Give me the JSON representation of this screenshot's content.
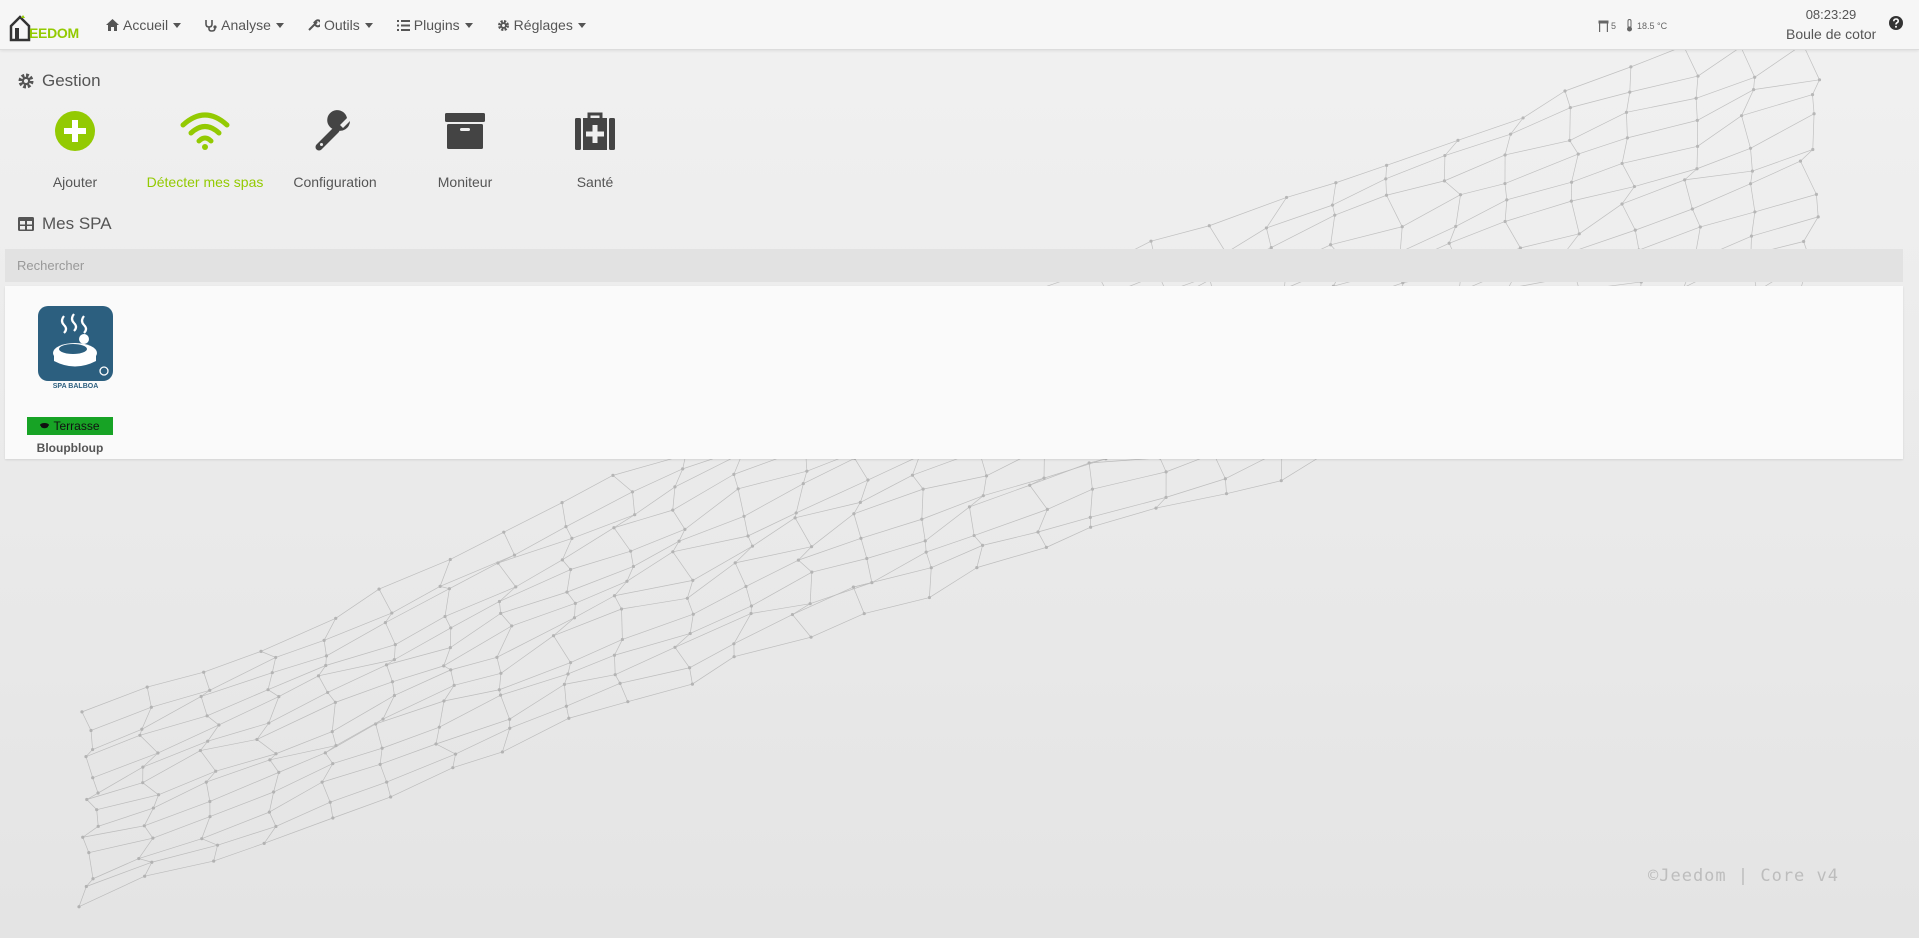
{
  "app": {
    "logo_text": "EEDOM"
  },
  "nav": {
    "items": [
      {
        "label": "Accueil",
        "icon": "home-icon"
      },
      {
        "label": "Analyse",
        "icon": "stethoscope-icon"
      },
      {
        "label": "Outils",
        "icon": "wrench-icon"
      },
      {
        "label": "Plugins",
        "icon": "list-icon"
      },
      {
        "label": "Réglages",
        "icon": "gear-icon"
      }
    ],
    "info_count": "5",
    "info_temp": "18.5 °C",
    "clock_time": "08:23:29",
    "clock_name": "Boule de coton"
  },
  "gestion": {
    "title": "Gestion",
    "cards": [
      {
        "label": "Ajouter",
        "icon": "add-circle-icon"
      },
      {
        "label": "Détecter mes spas",
        "icon": "wifi-icon"
      },
      {
        "label": "Configuration",
        "icon": "wrench-icon"
      },
      {
        "label": "Moniteur",
        "icon": "archive-icon"
      },
      {
        "label": "Santé",
        "icon": "medkit-icon"
      }
    ]
  },
  "mes_spa": {
    "title": "Mes SPA",
    "search_placeholder": "Rechercher",
    "items": [
      {
        "brand": "SPA BALBOA",
        "tag": "Terrasse",
        "name": "Bloupbloup"
      }
    ]
  },
  "colors": {
    "accent": "#93ca02",
    "tag_green": "#17a325",
    "spa_blue": "#2c5f7f"
  },
  "footer": {
    "copyright": "©Jeedom | Core v4"
  }
}
